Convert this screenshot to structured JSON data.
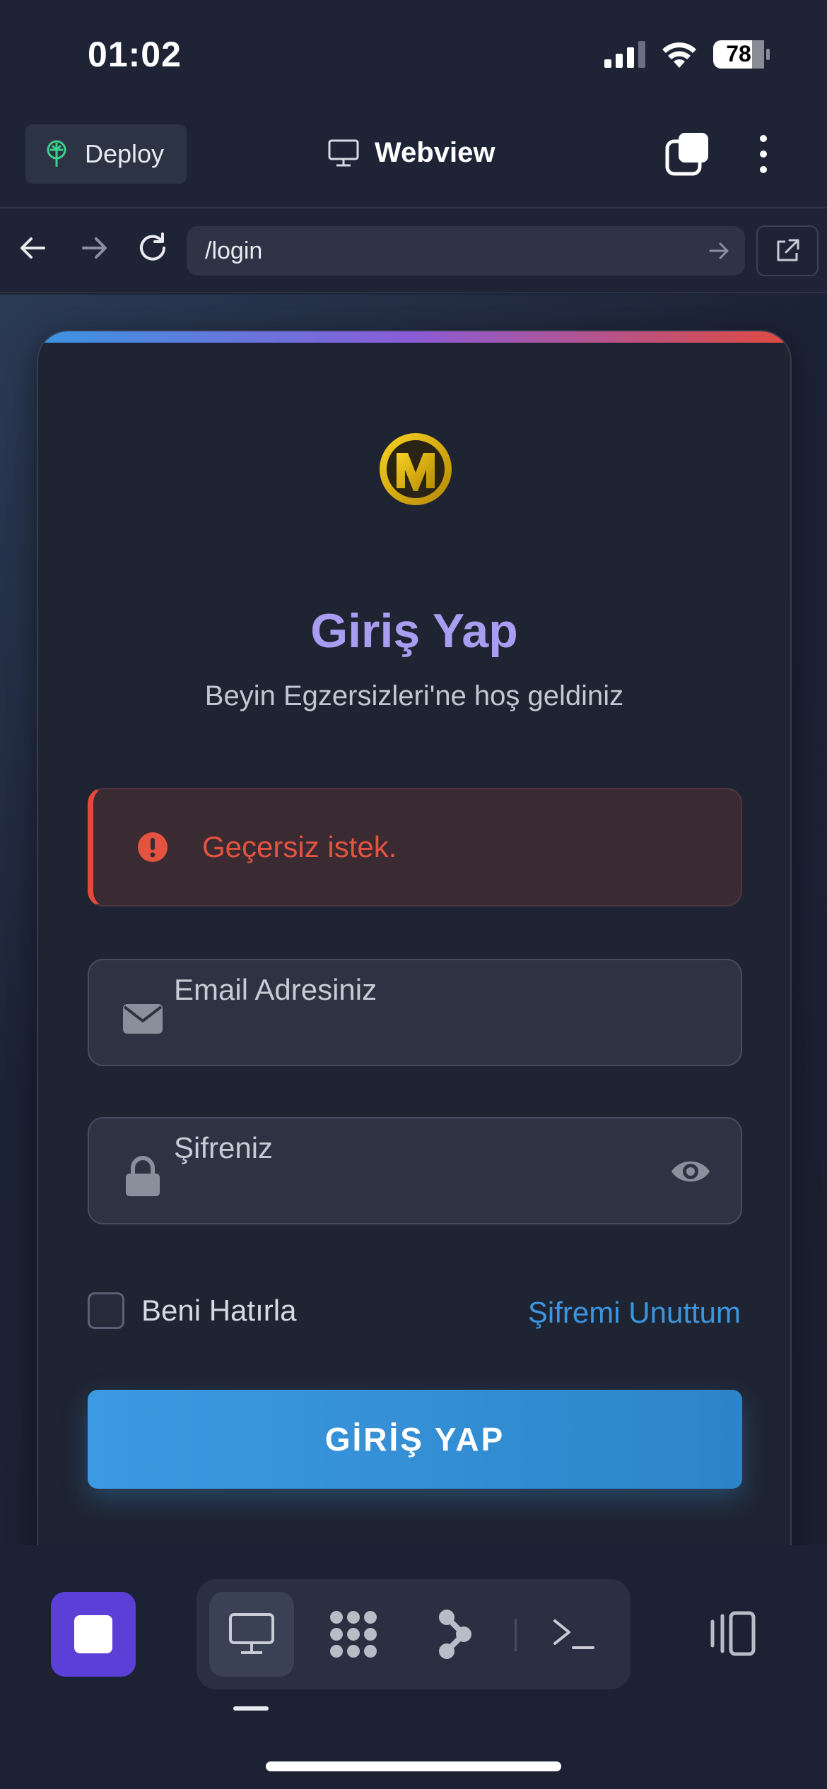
{
  "status_bar": {
    "time": "01:02",
    "battery": "78"
  },
  "appbar": {
    "deploy_label": "Deploy",
    "title": "Webview"
  },
  "urlbar": {
    "url": "/login"
  },
  "login": {
    "title": "Giriş Yap",
    "subtitle": "Beyin Egzersizleri'ne hoş geldiniz",
    "error": "Geçersiz istek.",
    "email_placeholder": "Email Adresiniz",
    "password_placeholder": "Şifreniz",
    "remember_label": "Beni Hatırla",
    "forgot_label": "Şifremi Unuttum",
    "submit_label": "GİRİŞ YAP"
  },
  "colors": {
    "accent_purple": "#a89df0",
    "error_red": "#e4533f",
    "link_blue": "#3b96e0",
    "button_blue": "#3b9ae2",
    "stop_purple": "#5b3fd6"
  },
  "bottombar": {
    "tools": [
      "webview-icon",
      "packages-icon",
      "git-icon",
      "terminal-icon"
    ]
  }
}
